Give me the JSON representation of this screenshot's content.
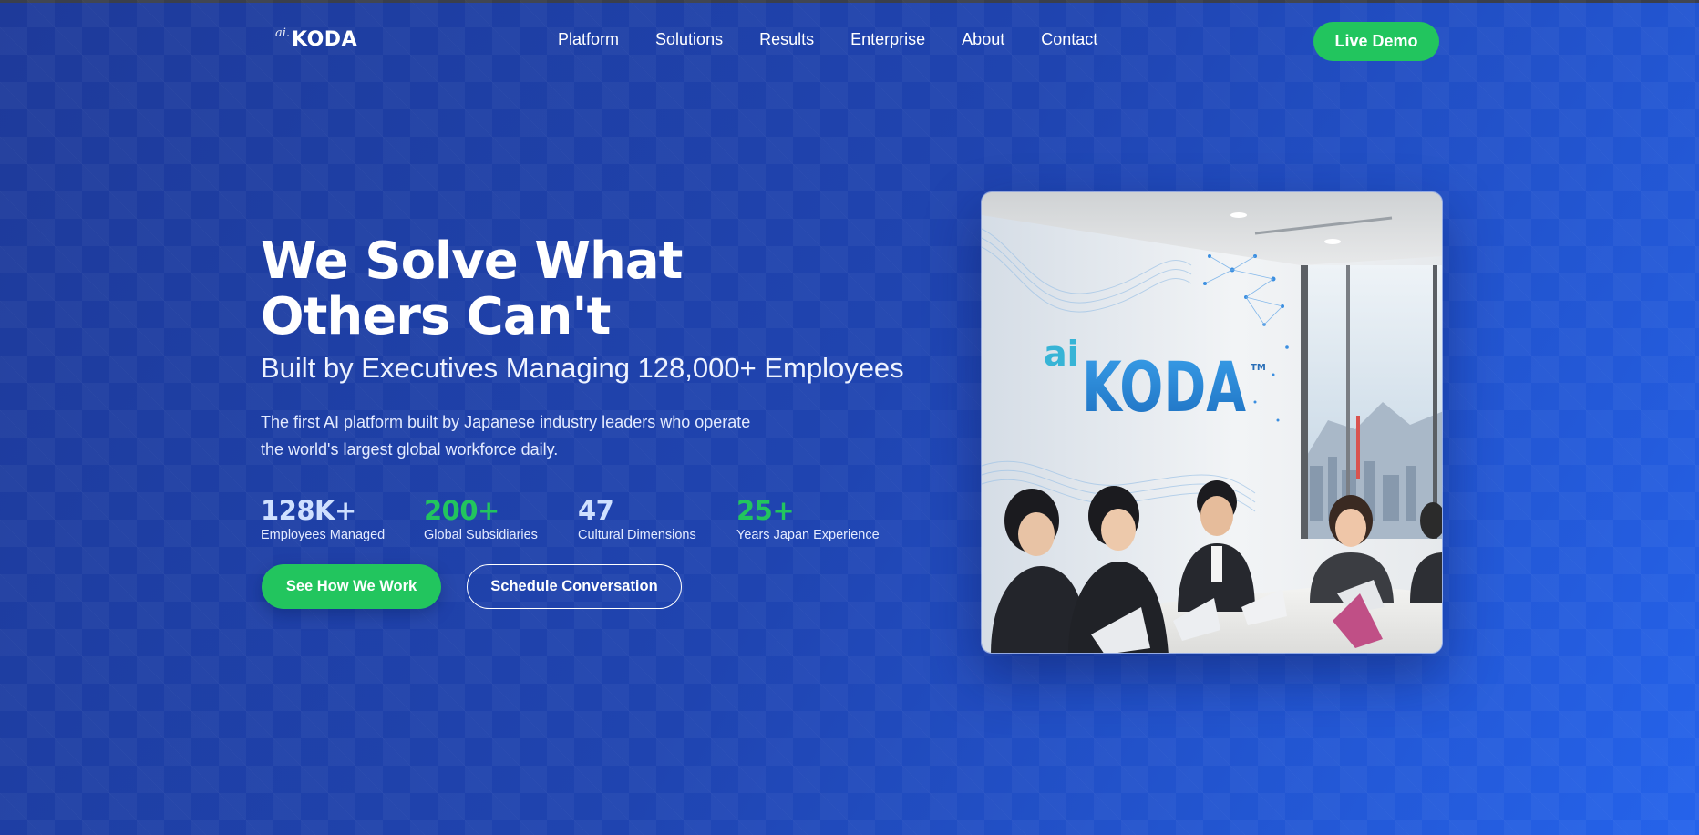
{
  "nav": {
    "logo_prefix": "ai.",
    "logo_word": "KODA",
    "links": [
      "Platform",
      "Solutions",
      "Results",
      "Enterprise",
      "About",
      "Contact"
    ],
    "cta": "Live Demo"
  },
  "hero": {
    "title_line1": "We Solve What",
    "title_line2": "Others Can't",
    "subtitle": "Built by Executives Managing 128,000+ Employees",
    "description": "The first AI platform built by Japanese industry leaders who operate the world's largest global workforce daily.",
    "stats": [
      {
        "value": "128K+",
        "label": "Employees Managed",
        "color": "#cfe0ff"
      },
      {
        "value": "200+",
        "label": "Global Subsidiaries",
        "color": "#22c55e"
      },
      {
        "value": "47",
        "label": "Cultural Dimensions",
        "color": "#cfe0ff"
      },
      {
        "value": "25+",
        "label": "Years Japan Experience",
        "color": "#22c55e"
      }
    ],
    "primary_button": "See How We Work",
    "secondary_button": "Schedule Conversation"
  },
  "photo": {
    "sign_prefix": "ai",
    "sign_word": "KODA",
    "sign_mark": "TM"
  },
  "colors": {
    "accent_green": "#22c55e",
    "background_blue": "#1f44b0",
    "stat_light": "#cfe0ff"
  }
}
